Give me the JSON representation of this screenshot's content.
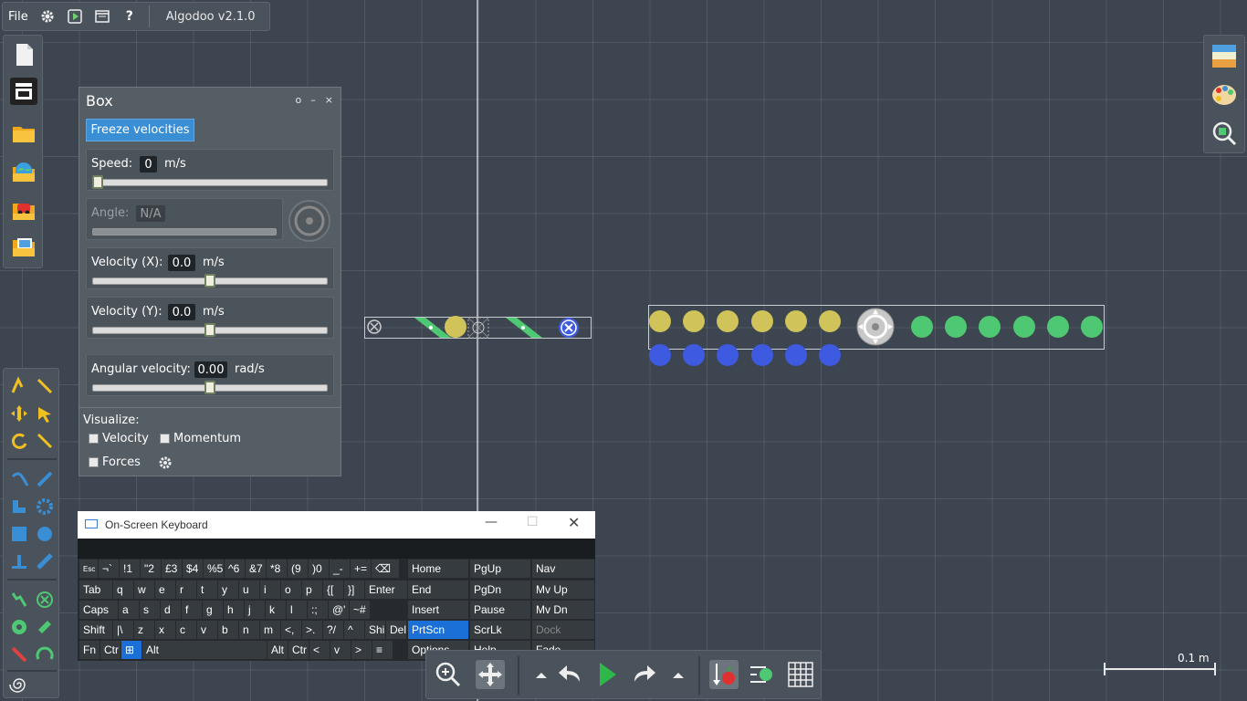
{
  "menu": {
    "file_label": "File",
    "app_title": "Algodoo v2.1.0",
    "icons": [
      "gear-icon",
      "play-scene-icon",
      "window-icon",
      "help-icon"
    ]
  },
  "panel": {
    "title": "Box",
    "controls": [
      "o",
      "–",
      "×"
    ],
    "freeze_label": "Freeze velocities",
    "speed": {
      "label": "Speed:",
      "value": "0",
      "unit": "m/s",
      "slider_fraction": 0.0
    },
    "angle": {
      "label": "Angle:",
      "value": "N/A"
    },
    "velocity_x": {
      "label": "Velocity (X):",
      "value": "0.0",
      "unit": "m/s",
      "slider_fraction": 0.5
    },
    "velocity_y": {
      "label": "Velocity (Y):",
      "value": "0.0",
      "unit": "m/s",
      "slider_fraction": 0.5
    },
    "angular_velocity": {
      "label": "Angular velocity:",
      "value": "0.00",
      "unit": "rad/s",
      "slider_fraction": 0.5
    },
    "visualize": {
      "heading": "Visualize:",
      "velocity": "Velocity",
      "momentum": "Momentum",
      "forces": "Forces"
    }
  },
  "osk": {
    "title": "On-Screen Keyboard",
    "row1": [
      "Esc",
      "¬`",
      "!1",
      "\"2",
      "£3",
      "$4",
      "%5",
      "^6",
      "&7",
      "*8",
      "(9",
      ")0",
      "_-",
      "+=",
      "⌫"
    ],
    "row2": [
      "Tab",
      "q",
      "w",
      "e",
      "r",
      "t",
      "y",
      "u",
      "i",
      "o",
      "p",
      "{[",
      "}]",
      "Enter"
    ],
    "row3": [
      "Caps",
      "a",
      "s",
      "d",
      "f",
      "g",
      "h",
      "j",
      "k",
      "l",
      ":;",
      "@'",
      "~#"
    ],
    "row4": [
      "Shift",
      "|\\",
      "z",
      "x",
      "c",
      "v",
      "b",
      "n",
      "m",
      "<,",
      ">.",
      "?/",
      "^",
      "Shi",
      "Del"
    ],
    "row5": [
      "Fn",
      "Ctr",
      "⊞",
      "Alt",
      "Alt",
      "Ctr",
      "<",
      "v",
      ">",
      "≡"
    ],
    "nav": [
      [
        "Home",
        "PgUp",
        "Nav"
      ],
      [
        "End",
        "PgDn",
        "Mv Up"
      ],
      [
        "Insert",
        "Pause",
        "Mv Dn"
      ],
      [
        "PrtScn",
        "ScrLk",
        "Dock"
      ],
      [
        "Options",
        "Help",
        "Fade"
      ]
    ]
  },
  "scale": {
    "label": "0.1 m"
  },
  "colors": {
    "accent": "#3a8ed4",
    "yellow_ball": "#cfc35a",
    "blue_ball": "#3d5ae0",
    "green_ball": "#4fc873"
  }
}
